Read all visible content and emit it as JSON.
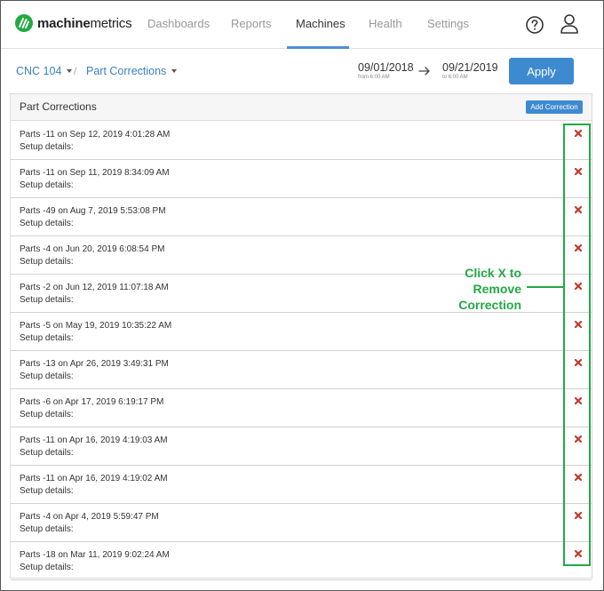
{
  "brand": {
    "bold": "machine",
    "light": "metrics",
    "accent": "#24a845"
  },
  "nav": {
    "items": [
      "Dashboards",
      "Reports",
      "Machines",
      "Health",
      "Settings"
    ],
    "active": "Machines"
  },
  "breadcrumb": {
    "machine": "CNC 104",
    "section": "Part Corrections",
    "separator": "/"
  },
  "dates": {
    "start": "09/01/2018",
    "start_sub": "from 6:00 AM",
    "end": "09/21/2019",
    "end_sub": "to 6:00 AM"
  },
  "apply_label": "Apply",
  "panel": {
    "title": "Part Corrections",
    "add_label": "Add Correction",
    "rows": [
      {
        "title": "Parts -11 on Sep 12, 2019 4:01:28 AM",
        "sub": "Setup details:"
      },
      {
        "title": "Parts -11 on Sep 11, 2019 8:34:09 AM",
        "sub": "Setup details:"
      },
      {
        "title": "Parts -49 on Aug 7, 2019 5:53:08 PM",
        "sub": "Setup details:"
      },
      {
        "title": "Parts -4 on Jun 20, 2019 6:08:54 PM",
        "sub": "Setup details:"
      },
      {
        "title": "Parts -2 on Jun 12, 2019 11:07:18 AM",
        "sub": "Setup details:"
      },
      {
        "title": "Parts -5 on May 19, 2019 10:35:22 AM",
        "sub": "Setup details:"
      },
      {
        "title": "Parts -13 on Apr 26, 2019 3:49:31 PM",
        "sub": "Setup details:"
      },
      {
        "title": "Parts -6 on Apr 17, 2019 6:19:17 PM",
        "sub": "Setup details:"
      },
      {
        "title": "Parts -11 on Apr 16, 2019 4:19:03 AM",
        "sub": "Setup details:"
      },
      {
        "title": "Parts -11 on Apr 16, 2019 4:19:02 AM",
        "sub": "Setup details:"
      },
      {
        "title": "Parts -4 on Apr 4, 2019 5:59:47 PM",
        "sub": "Setup details:"
      },
      {
        "title": "Parts -18 on Mar 11, 2019 9:02:24 AM",
        "sub": "Setup details:"
      }
    ]
  },
  "annotation": {
    "lines": [
      "Click X to",
      "Remove",
      "Correction"
    ],
    "color": "#24a845"
  },
  "colors": {
    "primary": "#3e8ad1",
    "link": "#3b7fc4",
    "delete": "#c0392b"
  },
  "icons": {
    "help": "help-circle-icon",
    "user": "user-icon",
    "arrow": "arrow-right-icon",
    "delete": "close-x-icon"
  }
}
